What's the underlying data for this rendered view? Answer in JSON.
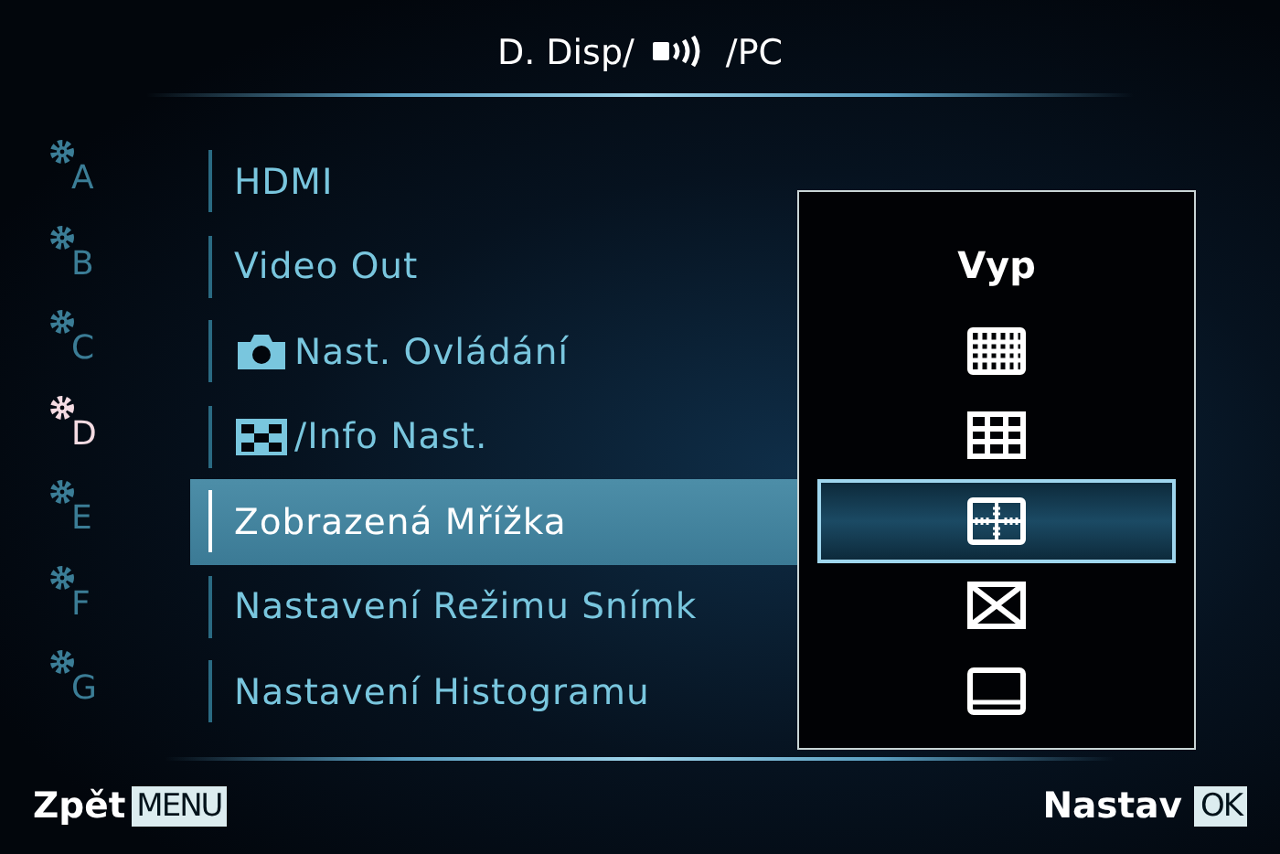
{
  "title": {
    "before": "D. Disp/",
    "after": "/PC"
  },
  "side_tabs": [
    {
      "label": "A",
      "selected": false
    },
    {
      "label": "B",
      "selected": false
    },
    {
      "label": "C",
      "selected": false
    },
    {
      "label": "D",
      "selected": true
    },
    {
      "label": "E",
      "selected": false
    },
    {
      "label": "F",
      "selected": false
    },
    {
      "label": "G",
      "selected": false
    }
  ],
  "menu_items": [
    {
      "kind": "text",
      "label": "HDMI",
      "selected": false
    },
    {
      "kind": "text",
      "label": "Video Out",
      "selected": false
    },
    {
      "kind": "camera",
      "label": "Nast. Ovládání",
      "selected": false
    },
    {
      "kind": "liveview",
      "label": "/Info Nast.",
      "selected": false
    },
    {
      "kind": "text",
      "label": "Zobrazená Mřížka",
      "selected": true
    },
    {
      "kind": "text",
      "label": "Nastavení Režimu Snímk",
      "selected": false
    },
    {
      "kind": "text",
      "label": "Nastavení Histogramu",
      "selected": false
    }
  ],
  "options": [
    {
      "kind": "text",
      "label": "Vyp",
      "selected": false
    },
    {
      "kind": "grid-fine",
      "selected": false
    },
    {
      "kind": "grid-thirds",
      "selected": false
    },
    {
      "kind": "scale",
      "selected": true
    },
    {
      "kind": "diagonal",
      "selected": false
    },
    {
      "kind": "frame",
      "selected": false
    }
  ],
  "footer": {
    "back_label": "Zpět",
    "back_key": "MENU",
    "set_label": "Nastav",
    "set_key": "OK"
  }
}
